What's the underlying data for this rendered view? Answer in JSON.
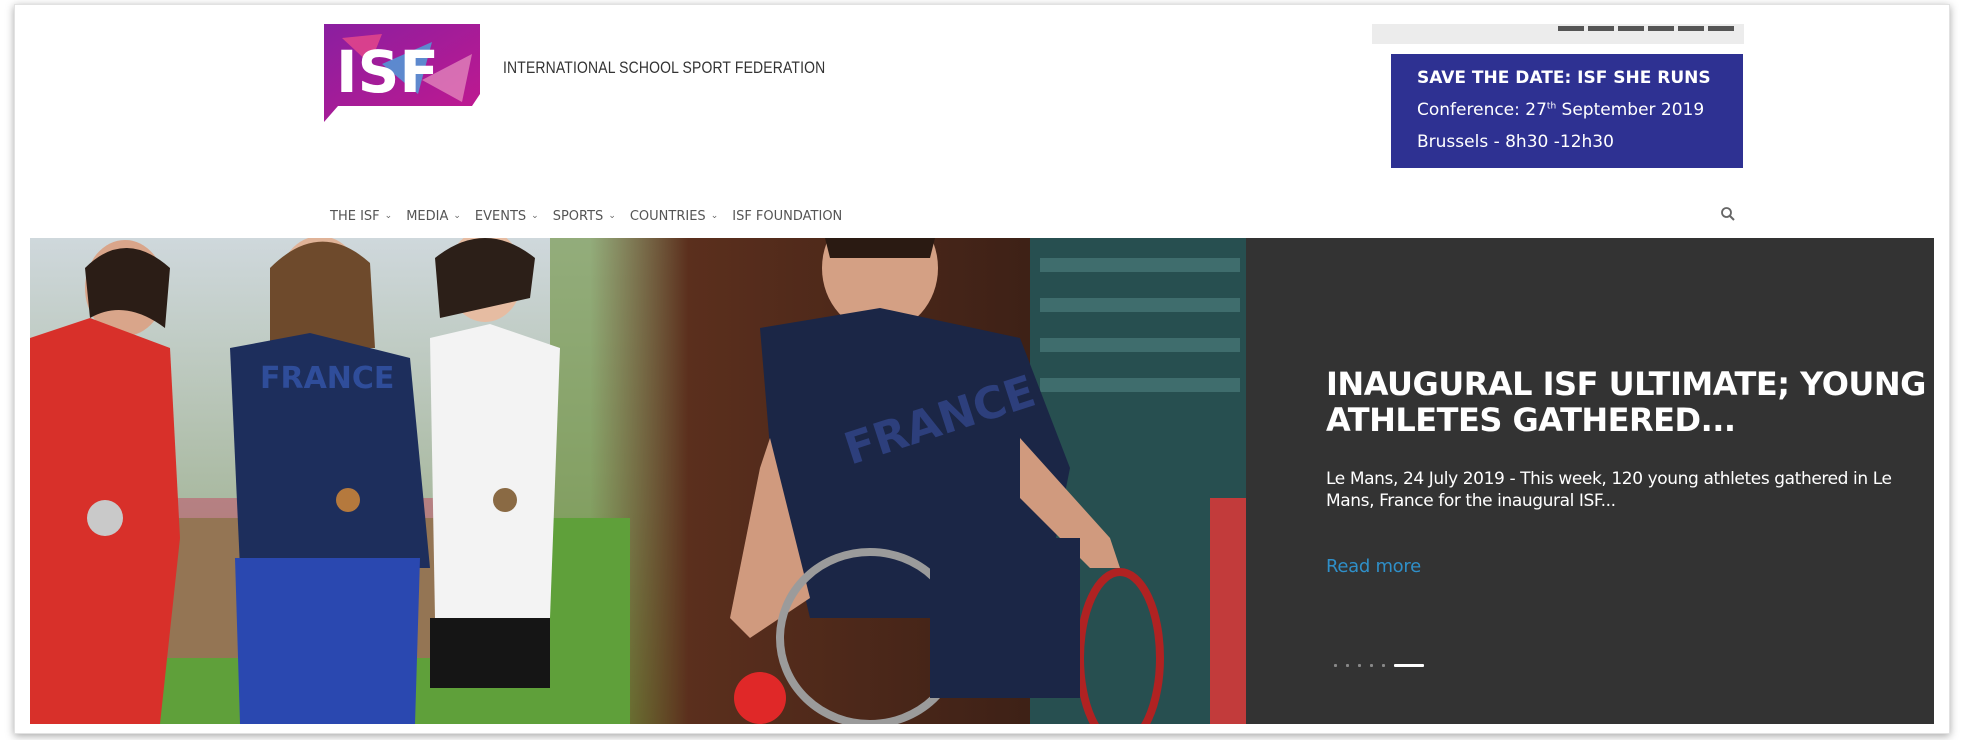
{
  "header": {
    "logo_text": "ISF",
    "org_name": "INTERNATIONAL SCHOOL SPORT FEDERATION"
  },
  "promo": {
    "title": "SAVE THE DATE: ISF SHE RUNS",
    "line2_prefix": "Conference: 27",
    "line2_sup": "th",
    "line2_suffix": " September 2019",
    "line3": "Brussels - 8h30 -12h30",
    "bg_color": "#2e3192"
  },
  "nav": {
    "items": [
      {
        "label": "THE ISF",
        "has_dropdown": true
      },
      {
        "label": "MEDIA",
        "has_dropdown": true
      },
      {
        "label": "EVENTS",
        "has_dropdown": true
      },
      {
        "label": "SPORTS",
        "has_dropdown": true
      },
      {
        "label": "COUNTRIES",
        "has_dropdown": true
      },
      {
        "label": "ISF FOUNDATION",
        "has_dropdown": false
      }
    ],
    "chevron": "⌄",
    "search_icon": "search-icon"
  },
  "hero": {
    "title": "INAUGURAL ISF ULTIMATE; YOUNG ATHLETES GATHERED...",
    "excerpt": "Le Mans, 24 July 2019 - This week, 120 young athletes gathered in Le Mans, France for the inaugural ISF...",
    "read_more": "Read more",
    "shirt_text_1": "FRANCE",
    "shirt_text_2": "FRANCE",
    "panel_color": "#333333",
    "link_color": "#2f8fc8",
    "slides_count": 6,
    "active_slide": 6
  }
}
